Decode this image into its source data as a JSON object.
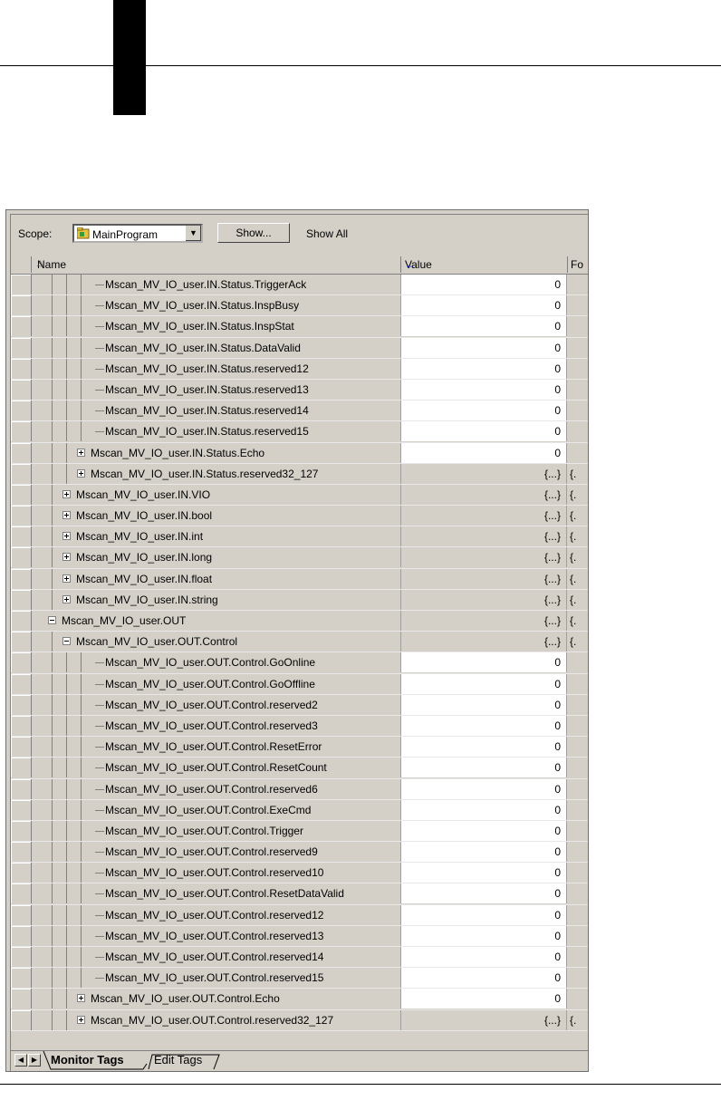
{
  "toolbar": {
    "scope_label": "Scope:",
    "scope_value": "MainProgram",
    "show_button": "Show...",
    "show_all": "Show All"
  },
  "columns": {
    "name": "Name",
    "value": "Value",
    "format": "Fo"
  },
  "tabs": {
    "monitor": "Monitor Tags",
    "edit": "Edit Tags"
  },
  "rows": [
    {
      "indent": 4,
      "expander": "",
      "name": "Mscan_MV_IO_user.IN.Status.TriggerAck",
      "value": "0",
      "editable": true
    },
    {
      "indent": 4,
      "expander": "",
      "name": "Mscan_MV_IO_user.IN.Status.InspBusy",
      "value": "0",
      "editable": true
    },
    {
      "indent": 4,
      "expander": "",
      "name": "Mscan_MV_IO_user.IN.Status.InspStat",
      "value": "0",
      "editable": true
    },
    {
      "indent": 4,
      "expander": "",
      "name": "Mscan_MV_IO_user.IN.Status.DataValid",
      "value": "0",
      "editable": true
    },
    {
      "indent": 4,
      "expander": "",
      "name": "Mscan_MV_IO_user.IN.Status.reserved12",
      "value": "0",
      "editable": true
    },
    {
      "indent": 4,
      "expander": "",
      "name": "Mscan_MV_IO_user.IN.Status.reserved13",
      "value": "0",
      "editable": true
    },
    {
      "indent": 4,
      "expander": "",
      "name": "Mscan_MV_IO_user.IN.Status.reserved14",
      "value": "0",
      "editable": true
    },
    {
      "indent": 4,
      "expander": "",
      "name": "Mscan_MV_IO_user.IN.Status.reserved15",
      "value": "0",
      "editable": true
    },
    {
      "indent": 3,
      "expander": "plus",
      "name": "Mscan_MV_IO_user.IN.Status.Echo",
      "value": "0",
      "editable": true
    },
    {
      "indent": 3,
      "expander": "plus",
      "name": "Mscan_MV_IO_user.IN.Status.reserved32_127",
      "value": "{...}",
      "fmt": "{.",
      "editable": false
    },
    {
      "indent": 2,
      "expander": "plus",
      "name": "Mscan_MV_IO_user.IN.VIO",
      "value": "{...}",
      "fmt": "{.",
      "editable": false
    },
    {
      "indent": 2,
      "expander": "plus",
      "name": "Mscan_MV_IO_user.IN.bool",
      "value": "{...}",
      "fmt": "{.",
      "editable": false
    },
    {
      "indent": 2,
      "expander": "plus",
      "name": "Mscan_MV_IO_user.IN.int",
      "value": "{...}",
      "fmt": "{.",
      "editable": false
    },
    {
      "indent": 2,
      "expander": "plus",
      "name": "Mscan_MV_IO_user.IN.long",
      "value": "{...}",
      "fmt": "{.",
      "editable": false
    },
    {
      "indent": 2,
      "expander": "plus",
      "name": "Mscan_MV_IO_user.IN.float",
      "value": "{...}",
      "fmt": "{.",
      "editable": false
    },
    {
      "indent": 2,
      "expander": "plus",
      "name": "Mscan_MV_IO_user.IN.string",
      "value": "{...}",
      "fmt": "{.",
      "editable": false
    },
    {
      "indent": 1,
      "expander": "minus",
      "name": "Mscan_MV_IO_user.OUT",
      "value": "{...}",
      "fmt": "{.",
      "editable": false
    },
    {
      "indent": 2,
      "expander": "minus",
      "name": "Mscan_MV_IO_user.OUT.Control",
      "value": "{...}",
      "fmt": "{.",
      "editable": false
    },
    {
      "indent": 4,
      "expander": "",
      "name": "Mscan_MV_IO_user.OUT.Control.GoOnline",
      "value": "0",
      "editable": true
    },
    {
      "indent": 4,
      "expander": "",
      "name": "Mscan_MV_IO_user.OUT.Control.GoOffline",
      "value": "0",
      "editable": true
    },
    {
      "indent": 4,
      "expander": "",
      "name": "Mscan_MV_IO_user.OUT.Control.reserved2",
      "value": "0",
      "editable": true
    },
    {
      "indent": 4,
      "expander": "",
      "name": "Mscan_MV_IO_user.OUT.Control.reserved3",
      "value": "0",
      "editable": true
    },
    {
      "indent": 4,
      "expander": "",
      "name": "Mscan_MV_IO_user.OUT.Control.ResetError",
      "value": "0",
      "editable": true
    },
    {
      "indent": 4,
      "expander": "",
      "name": "Mscan_MV_IO_user.OUT.Control.ResetCount",
      "value": "0",
      "editable": true
    },
    {
      "indent": 4,
      "expander": "",
      "name": "Mscan_MV_IO_user.OUT.Control.reserved6",
      "value": "0",
      "editable": true
    },
    {
      "indent": 4,
      "expander": "",
      "name": "Mscan_MV_IO_user.OUT.Control.ExeCmd",
      "value": "0",
      "editable": true
    },
    {
      "indent": 4,
      "expander": "",
      "name": "Mscan_MV_IO_user.OUT.Control.Trigger",
      "value": "0",
      "editable": true
    },
    {
      "indent": 4,
      "expander": "",
      "name": "Mscan_MV_IO_user.OUT.Control.reserved9",
      "value": "0",
      "editable": true
    },
    {
      "indent": 4,
      "expander": "",
      "name": "Mscan_MV_IO_user.OUT.Control.reserved10",
      "value": "0",
      "editable": true
    },
    {
      "indent": 4,
      "expander": "",
      "name": "Mscan_MV_IO_user.OUT.Control.ResetDataValid",
      "value": "0",
      "editable": true
    },
    {
      "indent": 4,
      "expander": "",
      "name": "Mscan_MV_IO_user.OUT.Control.reserved12",
      "value": "0",
      "editable": true
    },
    {
      "indent": 4,
      "expander": "",
      "name": "Mscan_MV_IO_user.OUT.Control.reserved13",
      "value": "0",
      "editable": true
    },
    {
      "indent": 4,
      "expander": "",
      "name": "Mscan_MV_IO_user.OUT.Control.reserved14",
      "value": "0",
      "editable": true
    },
    {
      "indent": 4,
      "expander": "",
      "name": "Mscan_MV_IO_user.OUT.Control.reserved15",
      "value": "0",
      "editable": true
    },
    {
      "indent": 3,
      "expander": "plus",
      "name": "Mscan_MV_IO_user.OUT.Control.Echo",
      "value": "0",
      "editable": true
    },
    {
      "indent": 3,
      "expander": "plus",
      "name": "Mscan_MV_IO_user.OUT.Control.reserved32_127",
      "value": "{...}",
      "fmt": "{.",
      "editable": false
    }
  ]
}
